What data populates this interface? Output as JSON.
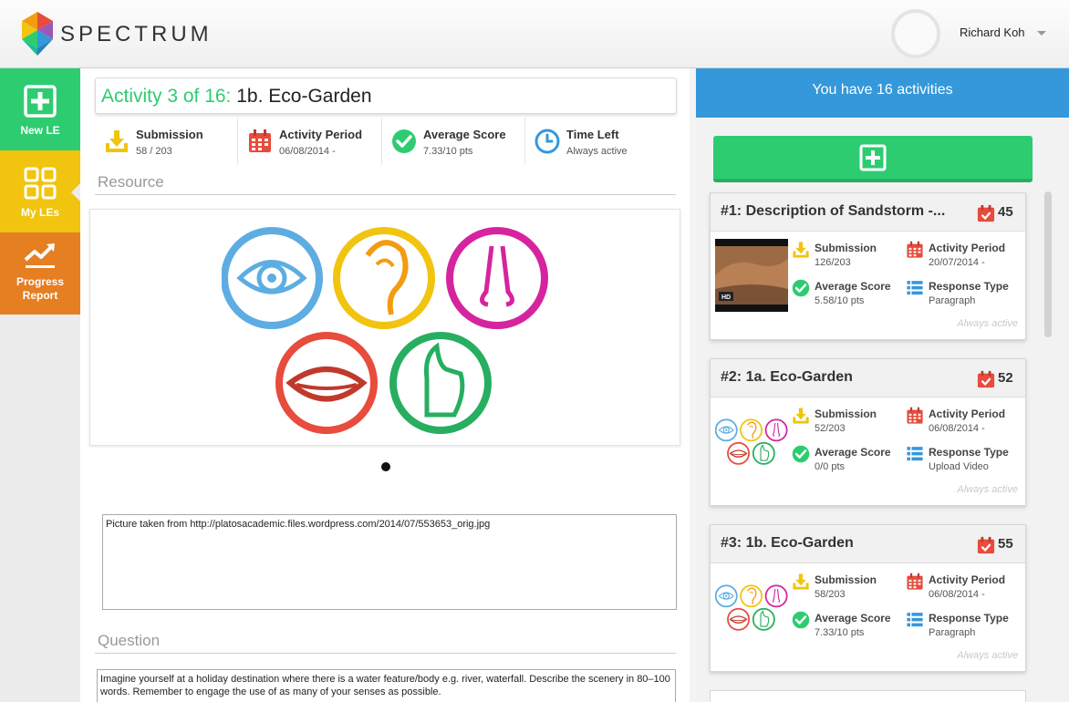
{
  "header": {
    "brand": "SPECTRUM",
    "user_name": "Richard Koh"
  },
  "sidebar": {
    "items": [
      {
        "label": "New LE",
        "color": "#2ecc71"
      },
      {
        "label": "My LEs",
        "color": "#f1c40f"
      },
      {
        "label": "Progress Report",
        "color": "#e67e22"
      }
    ]
  },
  "activity": {
    "title_prefix": "Activity 3 of 16:",
    "title_name": "1b. Eco-Garden",
    "stats": [
      {
        "label": "Submission",
        "value": "58 / 203",
        "icon": "download-icon"
      },
      {
        "label": "Activity Period",
        "value": "06/08/2014 -",
        "icon": "calendar-icon"
      },
      {
        "label": "Average Score",
        "value": "7.33/10 pts",
        "icon": "check-circle-icon"
      },
      {
        "label": "Time Left",
        "value": "Always active",
        "icon": "clock-icon"
      }
    ],
    "resource_heading": "Resource",
    "resource_caption": "Picture taken from http://platosacademic.files.wordpress.com/2014/07/553653_orig.jpg",
    "question_heading": "Question",
    "question_text": "Imagine yourself at a holiday destination where there is a water feature/body e.g. river, waterfall. Describe the scenery in 80–100 words. Remember to engage the use of as many of your senses as possible."
  },
  "activities_panel": {
    "header": "You have 16 activities",
    "cards": [
      {
        "title": "#1: Description of Sandstorm -...",
        "count": "45",
        "submission_label": "Submission",
        "submission": "126/203",
        "period_label": "Activity Period",
        "period": "20/07/2014 -",
        "score_label": "Average Score",
        "score": "5.58/10 pts",
        "response_label": "Response Type",
        "response": "Paragraph",
        "status": "Always active",
        "thumb_badge": "HD"
      },
      {
        "title": "#2: 1a. Eco-Garden",
        "count": "52",
        "submission_label": "Submission",
        "submission": "52/203",
        "period_label": "Activity Period",
        "period": "06/08/2014 -",
        "score_label": "Average Score",
        "score": "0/0 pts",
        "response_label": "Response Type",
        "response": "Upload Video",
        "status": "Always active"
      },
      {
        "title": "#3: 1b. Eco-Garden",
        "count": "55",
        "submission_label": "Submission",
        "submission": "58/203",
        "period_label": "Activity Period",
        "period": "06/08/2014 -",
        "score_label": "Average Score",
        "score": "7.33/10 pts",
        "response_label": "Response Type",
        "response": "Paragraph",
        "status": "Always active"
      }
    ]
  },
  "colors": {
    "green": "#2ecc71",
    "blue": "#3498db",
    "yellow": "#f1c40f",
    "orange": "#e67e22",
    "red": "#e74c3c"
  }
}
